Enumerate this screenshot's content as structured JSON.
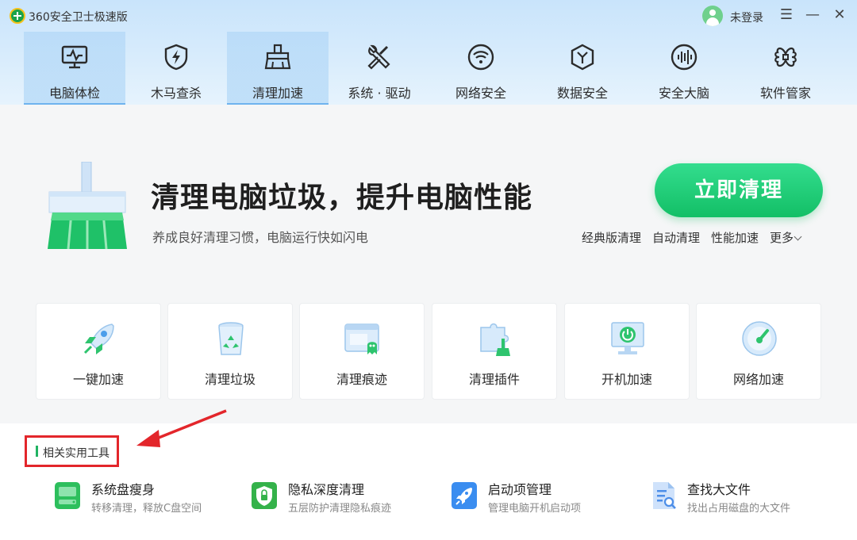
{
  "app": {
    "title": "360安全卫士极速版",
    "login_status": "未登录"
  },
  "nav": {
    "items": [
      {
        "label": "电脑体检",
        "icon": "monitor-pulse-icon",
        "active": true
      },
      {
        "label": "木马查杀",
        "icon": "shield-bolt-icon",
        "active": false
      },
      {
        "label": "清理加速",
        "icon": "broom-icon",
        "active": true
      },
      {
        "label": "系统 · 驱动",
        "icon": "wrench-screwdriver-icon",
        "active": false
      },
      {
        "label": "网络安全",
        "icon": "wifi-icon",
        "active": false
      },
      {
        "label": "数据安全",
        "icon": "hexagon-y-icon",
        "active": false
      },
      {
        "label": "安全大脑",
        "icon": "sound-wave-icon",
        "active": false
      },
      {
        "label": "软件管家",
        "icon": "clover-icon",
        "active": false
      }
    ]
  },
  "hero": {
    "title": "清理电脑垃圾，提升电脑性能",
    "subtitle": "养成良好清理习惯，电脑运行快如闪电",
    "button_label": "立即清理",
    "links": [
      "经典版清理",
      "自动清理",
      "性能加速",
      "更多"
    ]
  },
  "tools": [
    {
      "label": "一键加速",
      "icon": "rocket-icon"
    },
    {
      "label": "清理垃圾",
      "icon": "recycle-bin-icon"
    },
    {
      "label": "清理痕迹",
      "icon": "browser-ghost-icon"
    },
    {
      "label": "清理插件",
      "icon": "puzzle-broom-icon"
    },
    {
      "label": "开机加速",
      "icon": "power-monitor-icon"
    },
    {
      "label": "网络加速",
      "icon": "speedometer-icon"
    }
  ],
  "related": {
    "title": "相关实用工具",
    "items": [
      {
        "name": "系统盘瘦身",
        "desc": "转移清理，释放C盘空间",
        "icon": "disk-icon",
        "color": "#2dbf5d"
      },
      {
        "name": "隐私深度清理",
        "desc": "五层防护清理隐私痕迹",
        "icon": "privacy-shield-icon",
        "color": "#34b24a"
      },
      {
        "name": "启动项管理",
        "desc": "管理电脑开机启动项",
        "icon": "rocket-icon",
        "color": "#3a8df0"
      },
      {
        "name": "查找大文件",
        "desc": "找出占用磁盘的大文件",
        "icon": "file-search-icon",
        "color": "#4d8ee8"
      }
    ]
  },
  "colors": {
    "accent_green": "#1ec46c",
    "annotation_red": "#e3262b",
    "nav_bg": "#d3e9fb"
  }
}
